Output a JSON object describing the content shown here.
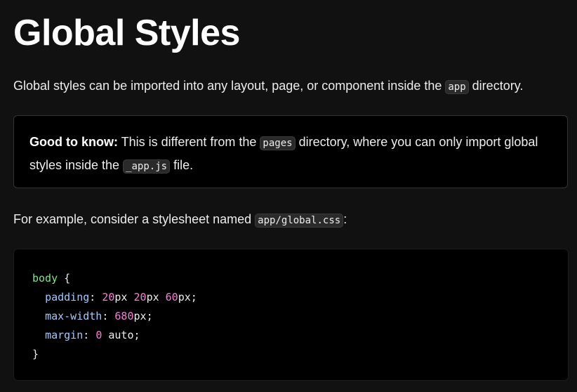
{
  "heading": "Global Styles",
  "intro": {
    "before": "Global styles can be imported into any layout, page, or component inside the ",
    "code": "app",
    "after": " directory."
  },
  "callout": {
    "label": "Good to know:",
    "text1": " This is different from the ",
    "code1": "pages",
    "text2": " directory, where you can only import global styles inside the ",
    "code2": "_app.js",
    "text3": " file."
  },
  "example": {
    "before": "For example, consider a stylesheet named ",
    "code": "app/global.css",
    "after": ":"
  },
  "code": {
    "selector": "body",
    "open_brace": " {",
    "lines": [
      {
        "prop": "padding",
        "parts": [
          {
            "num": "20",
            "unit": "px"
          },
          {
            "num": "20",
            "unit": "px"
          },
          {
            "num": "60",
            "unit": "px"
          }
        ]
      },
      {
        "prop": "max-width",
        "parts": [
          {
            "num": "680",
            "unit": "px"
          }
        ]
      },
      {
        "prop": "margin",
        "parts": [
          {
            "num": "0",
            "unit": ""
          },
          {
            "num": "",
            "unit": "auto"
          }
        ]
      }
    ],
    "close_brace": "}"
  },
  "colors": {
    "background": "#111111",
    "selector": "#7ee787",
    "property": "#9ecbff",
    "number": "#f47fd6"
  }
}
